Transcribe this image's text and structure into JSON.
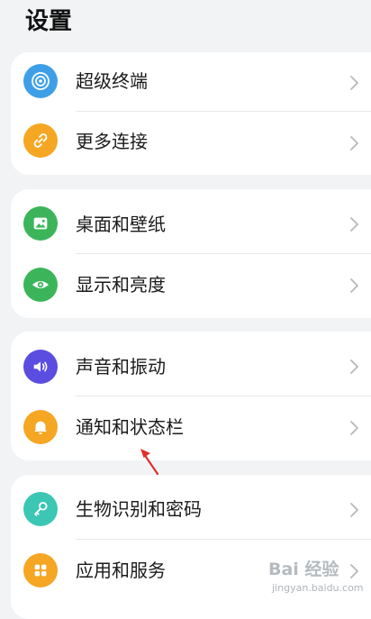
{
  "page": {
    "title": "设置"
  },
  "groups": [
    {
      "items": [
        {
          "label": "超级终端",
          "icon": "super-device-icon",
          "color": "#3f9fe6"
        },
        {
          "label": "更多连接",
          "icon": "link-icon",
          "color": "#f5a623"
        }
      ]
    },
    {
      "items": [
        {
          "label": "桌面和壁纸",
          "icon": "wallpaper-icon",
          "color": "#3cb55a"
        },
        {
          "label": "显示和亮度",
          "icon": "eye-icon",
          "color": "#3cb55a"
        }
      ]
    },
    {
      "items": [
        {
          "label": "声音和振动",
          "icon": "speaker-icon",
          "color": "#5b4de0"
        },
        {
          "label": "通知和状态栏",
          "icon": "bell-icon",
          "color": "#f5a623"
        }
      ]
    },
    {
      "items": [
        {
          "label": "生物识别和密码",
          "icon": "key-icon",
          "color": "#3cc6b4"
        },
        {
          "label": "应用和服务",
          "icon": "apps-icon",
          "color": "#f5a623"
        }
      ]
    }
  ],
  "annotation": {
    "arrow_color": "#e0302a"
  },
  "watermark": {
    "main": "Bai 经验",
    "sub": "jingyan.baidu.com"
  }
}
